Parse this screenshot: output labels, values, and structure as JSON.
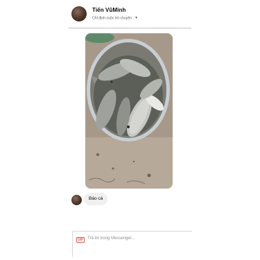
{
  "header": {
    "name": "Tiến VũMinh",
    "subtitle": "Chỉ định cuộc trò chuyện",
    "chevron_icon": "chevron-down-icon"
  },
  "message": {
    "text": "Báo cá"
  },
  "composer": {
    "placeholder": "Trả lời trong Messenger...",
    "gif_label": "GIF"
  }
}
